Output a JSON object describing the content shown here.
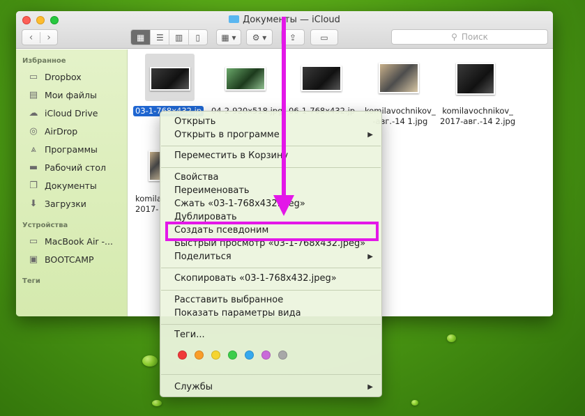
{
  "window": {
    "title": "Документы — iCloud",
    "search_placeholder": "Поиск"
  },
  "toolbar": {
    "back": "‹",
    "forward": "›"
  },
  "sidebar": {
    "favorites_header": "Избранное",
    "favorites": [
      {
        "label": "Dropbox",
        "icon": "folder-icon"
      },
      {
        "label": "Мои файлы",
        "icon": "files-icon"
      },
      {
        "label": "iCloud Drive",
        "icon": "cloud-icon"
      },
      {
        "label": "AirDrop",
        "icon": "airdrop-icon"
      },
      {
        "label": "Программы",
        "icon": "apps-icon"
      },
      {
        "label": "Рабочий стол",
        "icon": "desktop-icon"
      },
      {
        "label": "Документы",
        "icon": "document-icon"
      },
      {
        "label": "Загрузки",
        "icon": "download-icon"
      }
    ],
    "devices_header": "Устройства",
    "devices": [
      {
        "label": "MacBook Air -...",
        "icon": "laptop-icon"
      },
      {
        "label": "BOOTCAMP",
        "icon": "disk-icon"
      }
    ],
    "tags_header": "Теги"
  },
  "files": [
    {
      "name": "03-1-768x432.jp",
      "selected": true
    },
    {
      "name": "04-2-920x518.jpg"
    },
    {
      "name": "06-1-768x432.jp"
    },
    {
      "name_line1": "komilavochnikov_",
      "name_line2": "-авг.-14 1.jpg"
    },
    {
      "name_line1": "komilavochnikov_",
      "name_line2": "2017-авг.-14 2.jpg"
    },
    {
      "name_line1": "komila",
      "name_line2": "2017-"
    }
  ],
  "context_menu": {
    "items": [
      "Открыть",
      "Открыть в программе",
      "Переместить в Корзину",
      "Свойства",
      "Переименовать",
      "Сжать «03-1-768x432.jpeg»",
      "Дублировать",
      "Создать псевдоним",
      "Быстрый просмотр «03-1-768x432.jpeg»",
      "Поделиться",
      "Скопировать «03-1-768x432.jpeg»",
      "Расставить выбранное",
      "Показать параметры вида",
      "Теги...",
      "Службы"
    ],
    "tag_colors": [
      "#f0393a",
      "#f99d2a",
      "#f5d430",
      "#3ccd4b",
      "#35a9ee",
      "#c96ad9",
      "#a8a8a8"
    ],
    "highlight_color": "#e317e8"
  }
}
